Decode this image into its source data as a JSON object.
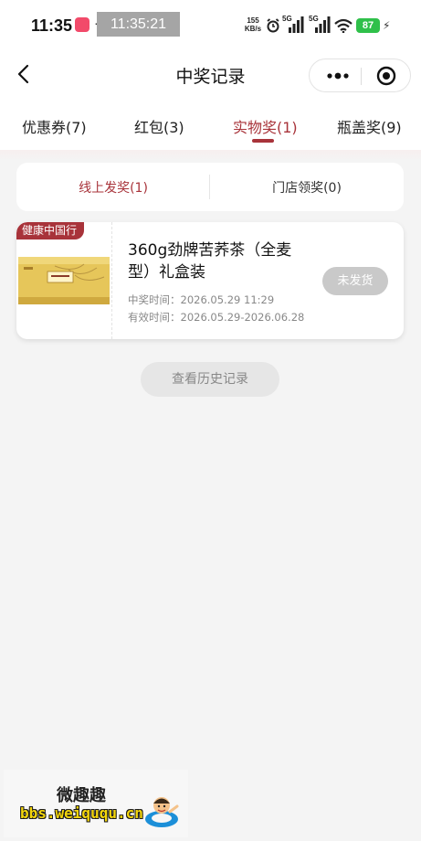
{
  "status_bar": {
    "time": "11:35",
    "more": "···",
    "overlay_time": "11:35:21",
    "net_speed": "155",
    "net_unit": "KB/s",
    "signal1": "5G",
    "signal2": "5G",
    "battery": "87"
  },
  "nav": {
    "title": "中奖记录"
  },
  "tabs": [
    {
      "label": "优惠券(7)"
    },
    {
      "label": "红包(3)"
    },
    {
      "label": "实物奖(1)"
    },
    {
      "label": "瓶盖奖(9)"
    }
  ],
  "active_tab_index": 2,
  "subtabs": [
    {
      "label": "线上发奖(1)"
    },
    {
      "label": "门店领奖(0)"
    }
  ],
  "prize": {
    "tag": "健康中国行",
    "product_image": "tea-gift-box",
    "title": "360g劲牌苦荞茶（全麦型）礼盒装",
    "win_time": "中奖时间：2026.05.29 11:29",
    "valid_time": "有效时间：2026.05.29-2026.06.28",
    "status": "未发货"
  },
  "history_button": "查看历史记录",
  "watermark": {
    "line1": "微趣趣",
    "line2": "bbs.weiququ.cn"
  },
  "colors": {
    "accent": "#a8333a",
    "background": "#f4f4f4",
    "battery": "#2fc04a",
    "watermark_url": "#f4d60c"
  }
}
